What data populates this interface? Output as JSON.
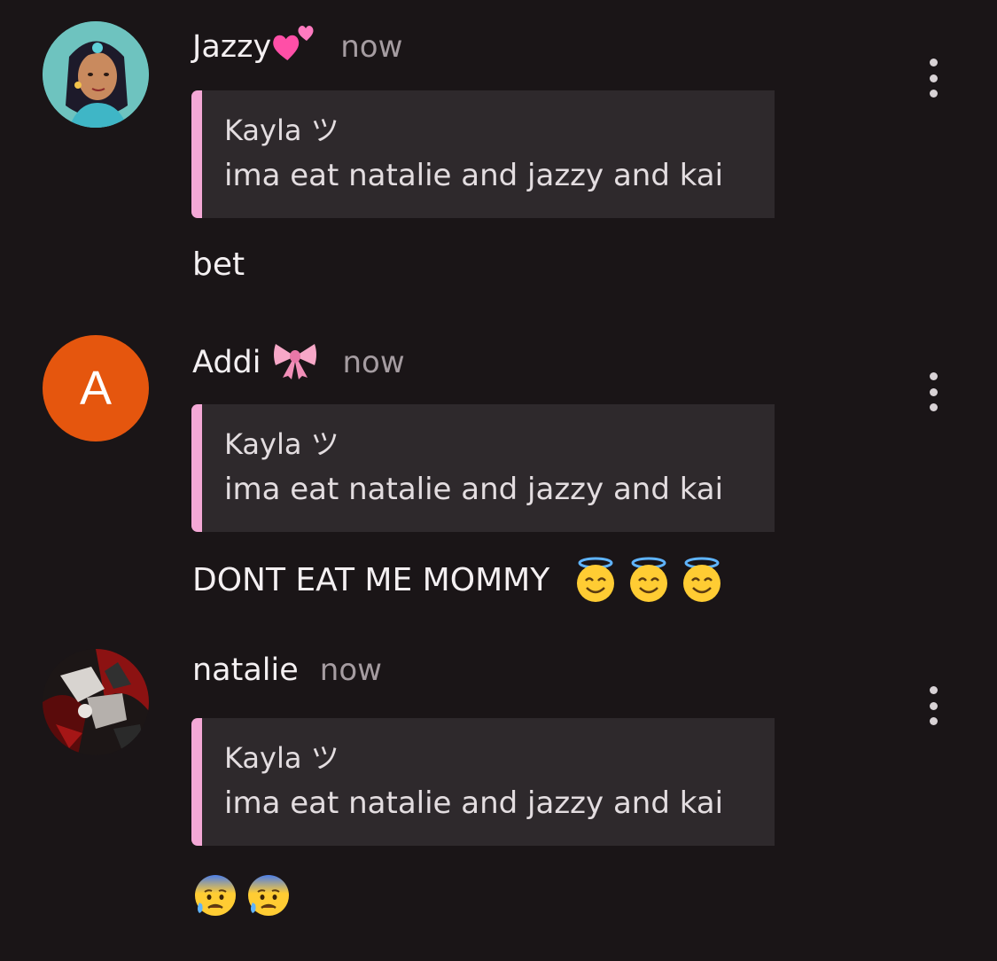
{
  "messages": [
    {
      "author": "Jazzy",
      "author_emoji": "two-hearts",
      "time": "now",
      "avatar": "jasmine-avatar",
      "reply": {
        "author": "Kayla ツ",
        "text": "ima eat natalie and jazzy and kai"
      },
      "text": "bet"
    },
    {
      "author": "Addi",
      "author_emoji": "ribbon",
      "time": "now",
      "avatar_letter": "A",
      "avatar_color": "#e5560e",
      "reply": {
        "author": "Kayla ツ",
        "text": "ima eat natalie and jazzy and kai"
      },
      "text": "DONT EAT ME MOMMY",
      "text_emojis": [
        "smiling-face-with-halo",
        "smiling-face-with-halo",
        "smiling-face-with-halo"
      ]
    },
    {
      "author": "natalie",
      "time": "now",
      "avatar": "natalie-avatar",
      "reply": {
        "author": "Kayla ツ",
        "text": "ima eat natalie and jazzy and kai"
      },
      "text_emojis": [
        "anxious-face-with-sweat",
        "anxious-face-with-sweat"
      ]
    }
  ],
  "colors": {
    "background": "#1a1517",
    "quote_background": "#2e292c",
    "quote_accent": "#f4a8d6",
    "timestamp": "#a59ca1"
  }
}
